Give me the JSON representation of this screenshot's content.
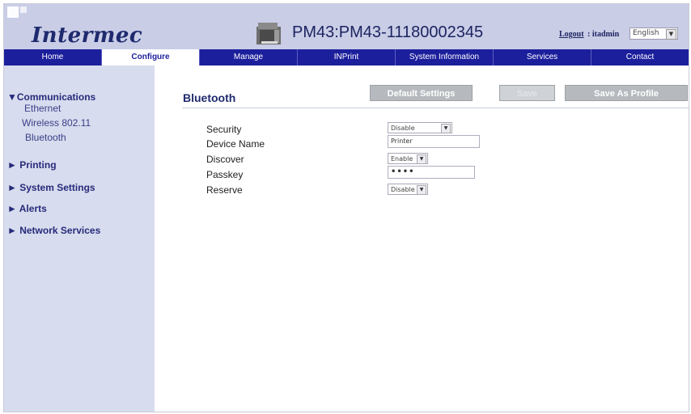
{
  "brand": {
    "logo_text": "Intermec",
    "printer_title": "PM43:PM43-11180002345"
  },
  "header": {
    "logout_label": "Logout",
    "user_label": ": itadmin",
    "language": {
      "selected": "English"
    }
  },
  "nav": {
    "tabs": [
      {
        "label": "Home"
      },
      {
        "label": "Configure",
        "active": true
      },
      {
        "label": "Manage"
      },
      {
        "label": "INPrint"
      },
      {
        "label": "System Information"
      },
      {
        "label": "Services"
      },
      {
        "label": "Contact"
      }
    ]
  },
  "sidebar": {
    "sections": [
      {
        "label": "▼Communications",
        "children": [
          "Ethernet",
          "Wireless 802.11",
          "Bluetooth"
        ]
      },
      {
        "label": "► Printing"
      },
      {
        "label": "► System Settings"
      },
      {
        "label": "► Alerts"
      },
      {
        "label": "► Network Services"
      }
    ]
  },
  "main": {
    "title": "Bluetooth",
    "buttons": {
      "default_settings": "Default Settings",
      "save": "Save",
      "save_as_profile": "Save As Profile"
    },
    "form": {
      "security": {
        "label": "Security",
        "value": "Disable"
      },
      "device_name": {
        "label": "Device Name",
        "value": "Printer"
      },
      "discover": {
        "label": "Discover",
        "value": "Enable"
      },
      "passkey": {
        "label": "Passkey",
        "value": "••••"
      },
      "reserve": {
        "label": "Reserve",
        "value": "Disable"
      }
    }
  },
  "colors": {
    "header_bg": "#c9cde6",
    "nav_bg": "#1c1f9c",
    "sidebar_bg": "#d7dcee",
    "button_bg": "#b6b9be",
    "brand_text": "#1f2a6e"
  }
}
